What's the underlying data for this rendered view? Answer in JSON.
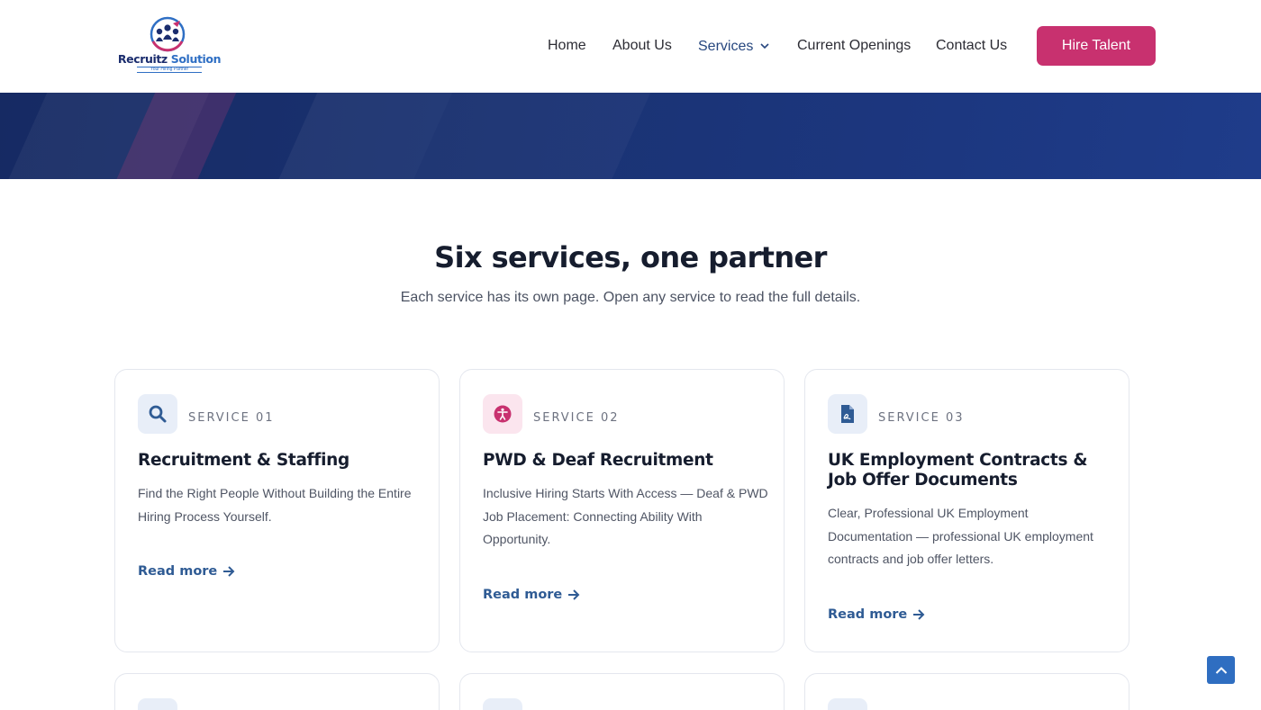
{
  "brand": {
    "name_part1": "Recruitz",
    "name_part2": "Solution",
    "tagline": "Your Hiring Partner",
    "colors": {
      "navy": "#1b2d6e",
      "blue": "#2f6fc4",
      "pink": "#c8316f"
    }
  },
  "nav": {
    "items": [
      {
        "label": "Home"
      },
      {
        "label": "About Us"
      },
      {
        "label": "Services",
        "active": true,
        "has_dropdown": true
      },
      {
        "label": "Current Openings"
      },
      {
        "label": "Contact Us"
      }
    ],
    "cta_label": "Hire Talent"
  },
  "section": {
    "title": "Six services, one partner",
    "subtitle": "Each service has its own page. Open any service to read the full details."
  },
  "cards": [
    {
      "eyebrow": "SERVICE 01",
      "title": "Recruitment & Staffing",
      "description": "Find the Right People Without Building the Entire Hiring Process Yourself.",
      "link_label": "Read more",
      "icon": "search-icon"
    },
    {
      "eyebrow": "SERVICE 02",
      "title": "PWD & Deaf Recruitment",
      "description": "Inclusive Hiring Starts With Access — Deaf & PWD Job Placement: Connecting Ability With Opportunity.",
      "link_label": "Read more",
      "icon": "accessibility-icon"
    },
    {
      "eyebrow": "SERVICE 03",
      "title": "UK Employment Contracts & Job Offer Documents",
      "description": "Clear, Professional UK Employment Documentation — professional UK employment contracts and job offer letters.",
      "link_label": "Read more",
      "icon": "document-icon"
    }
  ],
  "scroll_top_icon": "chevron-up-icon"
}
